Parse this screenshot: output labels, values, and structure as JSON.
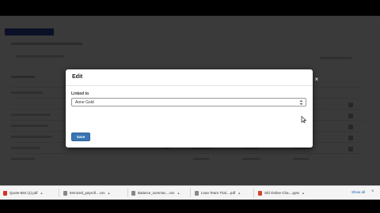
{
  "modal": {
    "title": "Edit",
    "field_label": "Linked to",
    "field_value": "Anne Gold",
    "save_label": "Save",
    "close_glyph": "×"
  },
  "downloads": {
    "items": [
      {
        "name": "Quote-584 (1).pdf",
        "icon": "pdf-file-icon",
        "color": "#d93025"
      },
      {
        "name": "Itemized_payroll....csv",
        "icon": "csv-file-icon",
        "color": "#888888"
      },
      {
        "name": "Balance_summar....csv",
        "icon": "csv-file-icon",
        "color": "#888888"
      },
      {
        "name": "Lean Team Trial....pdf",
        "icon": "pdf-file-icon",
        "color": "#888888"
      },
      {
        "name": "Sfd Online Cha....pptx",
        "icon": "pptx-file-icon",
        "color": "#d24726"
      }
    ],
    "show_all_label": "Show all",
    "close_glyph": "×"
  },
  "colors": {
    "save_button": "#3a76b3",
    "header_accent": "#2a3a8a"
  }
}
